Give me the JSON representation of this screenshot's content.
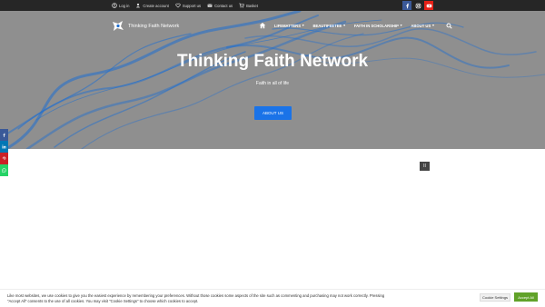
{
  "topbar": {
    "links": [
      {
        "label": "Log in",
        "icon": "login-icon"
      },
      {
        "label": "Create account",
        "icon": "user-icon"
      },
      {
        "label": "Support us",
        "icon": "heart-icon"
      },
      {
        "label": "Contact us",
        "icon": "envelope-icon"
      },
      {
        "label": "Basket",
        "icon": "cart-icon"
      }
    ],
    "socials": [
      {
        "icon": "facebook-icon",
        "color": "#3b5998"
      },
      {
        "icon": "instagram-icon",
        "color": "#222222"
      },
      {
        "icon": "youtube-icon",
        "color": "#e62117"
      }
    ]
  },
  "brand": {
    "name": "Thinking Faith Network"
  },
  "nav": {
    "items": [
      "LIFEMATTERS",
      "BEAUTIFEETEE",
      "FAITH IN SCHOLARSHIP",
      "ABOUT US"
    ],
    "home_icon": "home-icon",
    "search_icon": "search-icon"
  },
  "hero": {
    "title": "Thinking Faith Network",
    "subtitle": "Faith in all of life",
    "button": "ABOUT US",
    "accent": "#1a73e8"
  },
  "side_share": [
    {
      "icon": "facebook-icon",
      "color": "#3b5998"
    },
    {
      "icon": "linkedin-icon",
      "color": "#0077b5"
    },
    {
      "icon": "pinterest-icon",
      "color": "#cb2027"
    },
    {
      "icon": "whatsapp-icon",
      "color": "#25d366"
    }
  ],
  "pager": {
    "label": "II"
  },
  "cookie": {
    "text": "Like most websites, we use cookies to give you the easiest experience by remembering your preferences. Without those cookies some aspects of the site such as commenting and purchasing may not work correctly. Pressing \"Accept All\" consents to the use of all cookies. You may visit \"Cookie Settings\" to choose which cookies to accept.",
    "settings_label": "Cookie Settings",
    "accept_label": "Accept All",
    "accept_color": "#61a229"
  }
}
